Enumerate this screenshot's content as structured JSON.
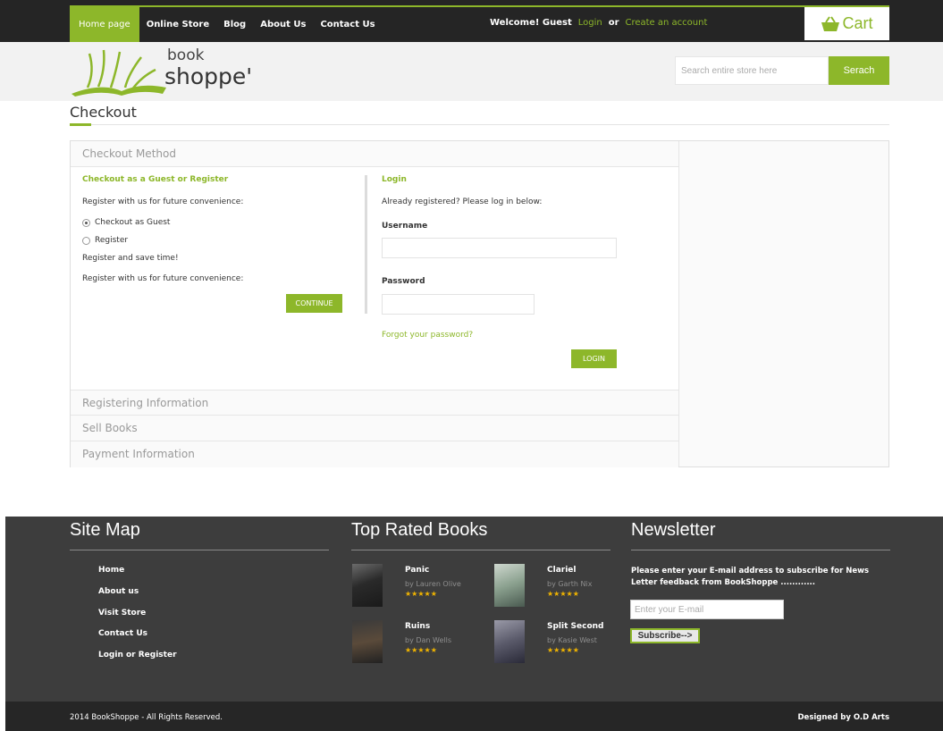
{
  "colors": {
    "accent": "#8db72a",
    "topbar": "#252525",
    "footer": "#3d3d3d",
    "footer_bottom": "#262626",
    "star": "#f0b400"
  },
  "nav": {
    "items": [
      {
        "label": "Home page",
        "active": true
      },
      {
        "label": "Online Store"
      },
      {
        "label": "Blog"
      },
      {
        "label": "About Us"
      },
      {
        "label": "Contact Us"
      }
    ]
  },
  "welcome": {
    "prefix": "Welcome! Guest",
    "login": "Login",
    "or": "or",
    "create": "Create an account"
  },
  "cart": {
    "label": "Cart",
    "icon": "basket-icon"
  },
  "logo": {
    "line1": "book",
    "line2": "shoppe'"
  },
  "search": {
    "placeholder": "Search entire store here",
    "button": "Serach"
  },
  "page": {
    "title": "Checkout"
  },
  "checkout": {
    "method_header": "Checkout Method",
    "guest_heading": "Checkout as a Guest or Register",
    "register_prompt": "Register with us for future convenience:",
    "options": [
      {
        "label": "Checkout as Guest",
        "selected": true
      },
      {
        "label": "Register",
        "selected": false
      }
    ],
    "save_time": "Register and save time!",
    "register_prompt2": "Register with us for future convenience:",
    "continue": "CONTINUE",
    "login_heading": "Login",
    "login_prompt": "Already registered? Please log in below:",
    "username_label": "Username",
    "password_label": "Password",
    "forgot": "Forgot your password?",
    "login_button": "LOGIN",
    "sections": [
      "Registering Information",
      "Sell Books",
      "Payment Information"
    ]
  },
  "footer": {
    "sitemap": {
      "heading": "Site Map",
      "links": [
        "Home",
        "About us",
        "Visit Store",
        "Contact Us",
        "Login or Register"
      ]
    },
    "top_rated": {
      "heading": "Top Rated Books",
      "books": [
        {
          "title": "Panic",
          "author": "by Lauren Olive",
          "rating": 5,
          "stars": "★★★★★"
        },
        {
          "title": "Clariel",
          "author": "by Garth Nix",
          "rating": 5,
          "stars": "★★★★★"
        },
        {
          "title": "Ruins",
          "author": "by Dan Wells",
          "rating": 5,
          "stars": "★★★★★"
        },
        {
          "title": "Split Second",
          "author": "by Kasie West",
          "rating": 5,
          "stars": "★★★★★"
        }
      ]
    },
    "newsletter": {
      "heading": "Newsletter",
      "text": "Please enter your E-mail address to subscribe for News Letter feedback from BookShoppe ............",
      "placeholder": "Enter your E-mail",
      "button": "Subscribe-->"
    },
    "copyright": "2014 BookShoppe - All Rights Reserved.",
    "designed": "Designed by O.D Arts"
  }
}
